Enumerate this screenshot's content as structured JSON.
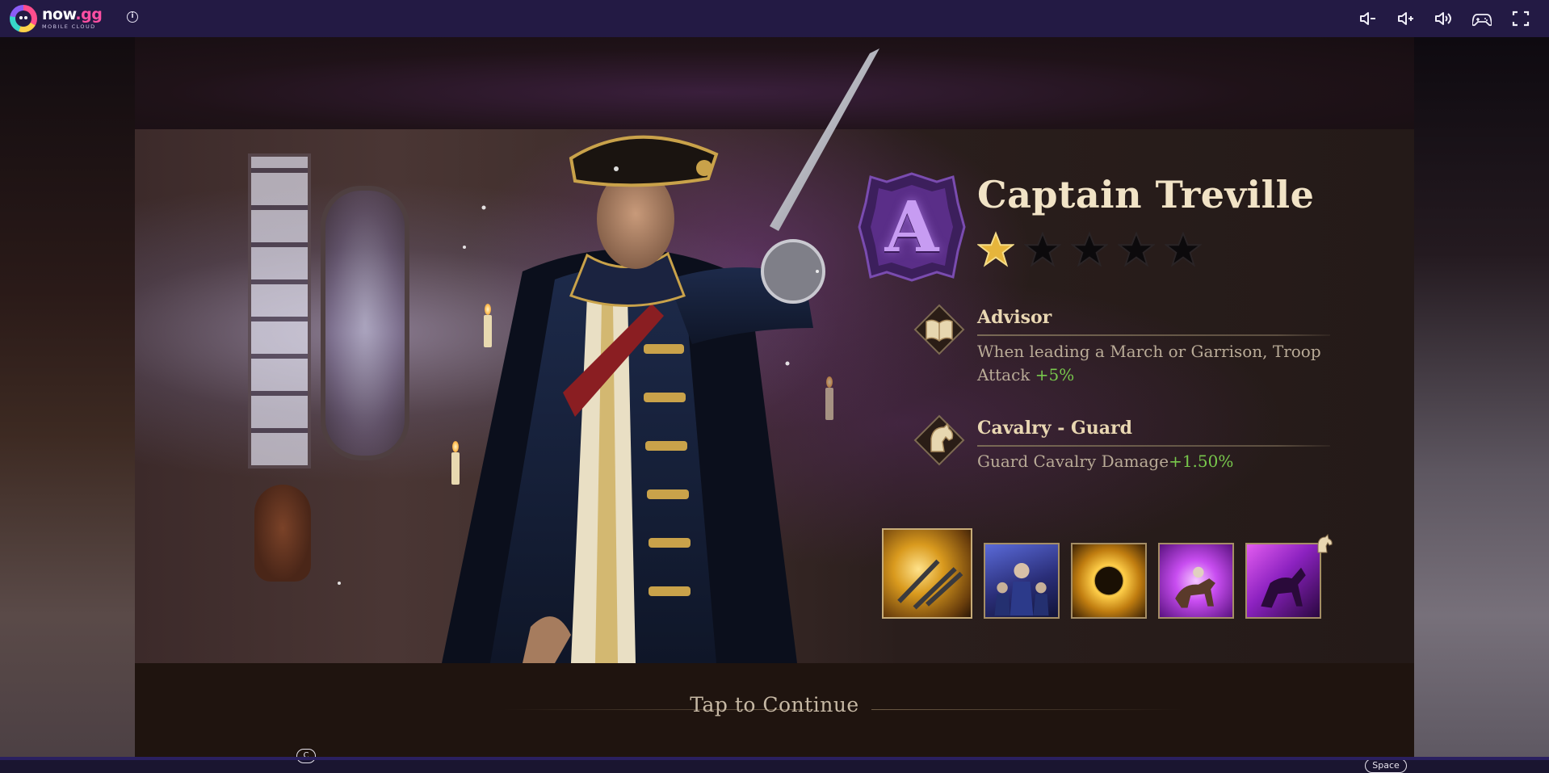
{
  "app": {
    "logo_name": "now",
    "logo_tld": ".gg",
    "logo_sub": "MOBILE CLOUD",
    "info_glyph": "i"
  },
  "toolbar": {
    "buttons": [
      "volume-down-icon",
      "volume-up-icon",
      "volume-mute-icon",
      "gamepad-icon",
      "fullscreen-icon"
    ]
  },
  "hero": {
    "rank": "A",
    "name": "Captain Treville",
    "stars_total": 5,
    "stars_filled": 1,
    "traits": [
      {
        "title": "Advisor",
        "icon": "book-icon",
        "desc_text": "When leading a March or Garrison, Troop Attack ",
        "desc_value": "+5%"
      },
      {
        "title": "Cavalry - Guard",
        "icon": "horse-head-icon",
        "desc_text": "Guard Cavalry Damage",
        "desc_value": "+1.50%"
      }
    ],
    "skills": [
      "musket-volley-skill",
      "infantry-squad-skill",
      "golden-orb-skill",
      "cavalry-charge-skill",
      "cavalry-shadow-skill"
    ]
  },
  "footer": {
    "tap_label": "Tap to Continue",
    "key_c": "C",
    "key_space": "Space"
  },
  "colors": {
    "accent_gold": "#f1e3c6",
    "bonus_green": "#78c84c",
    "topbar": "#231a44",
    "rank_purple": "#6a3aa8"
  }
}
